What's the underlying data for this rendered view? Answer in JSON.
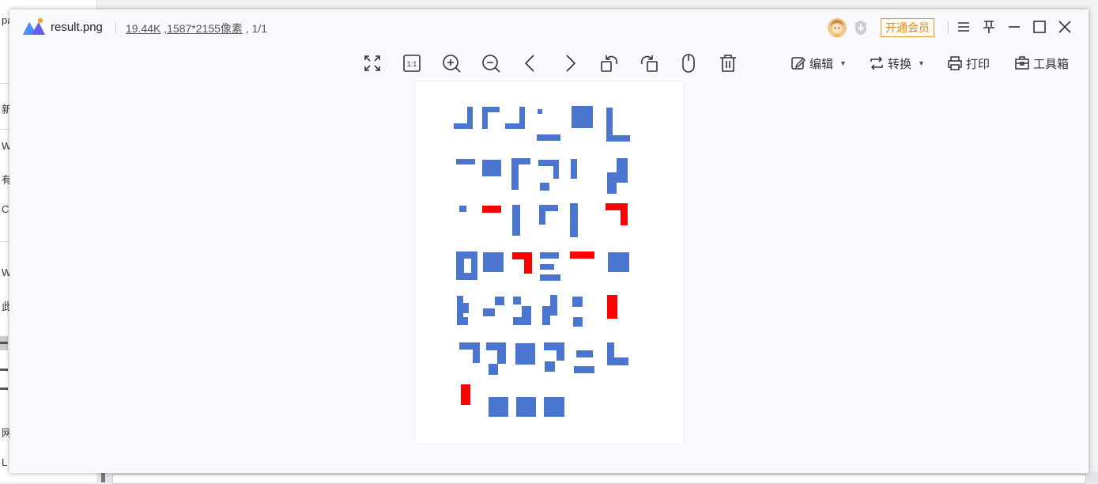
{
  "background_app": {
    "left_strip_rows": [
      "pas",
      "新建",
      "W",
      "有",
      "C",
      "W",
      "此",
      "网",
      "L"
    ]
  },
  "viewer": {
    "filename": "result.png",
    "filesize": "19.44K",
    "dimensions": ",1587*2155像素",
    "page_indicator": ", 1/1",
    "vip_button": "开通会员",
    "toolbar": {
      "edit_label": "编辑",
      "convert_label": "转换",
      "print_label": "打印",
      "toolbox_label": "工具箱"
    }
  },
  "image_content": {
    "colors": {
      "blue": "#4a76cf",
      "red": "#ff0000"
    },
    "description_marks": "grid of blue and red blocky glyph fragments"
  }
}
